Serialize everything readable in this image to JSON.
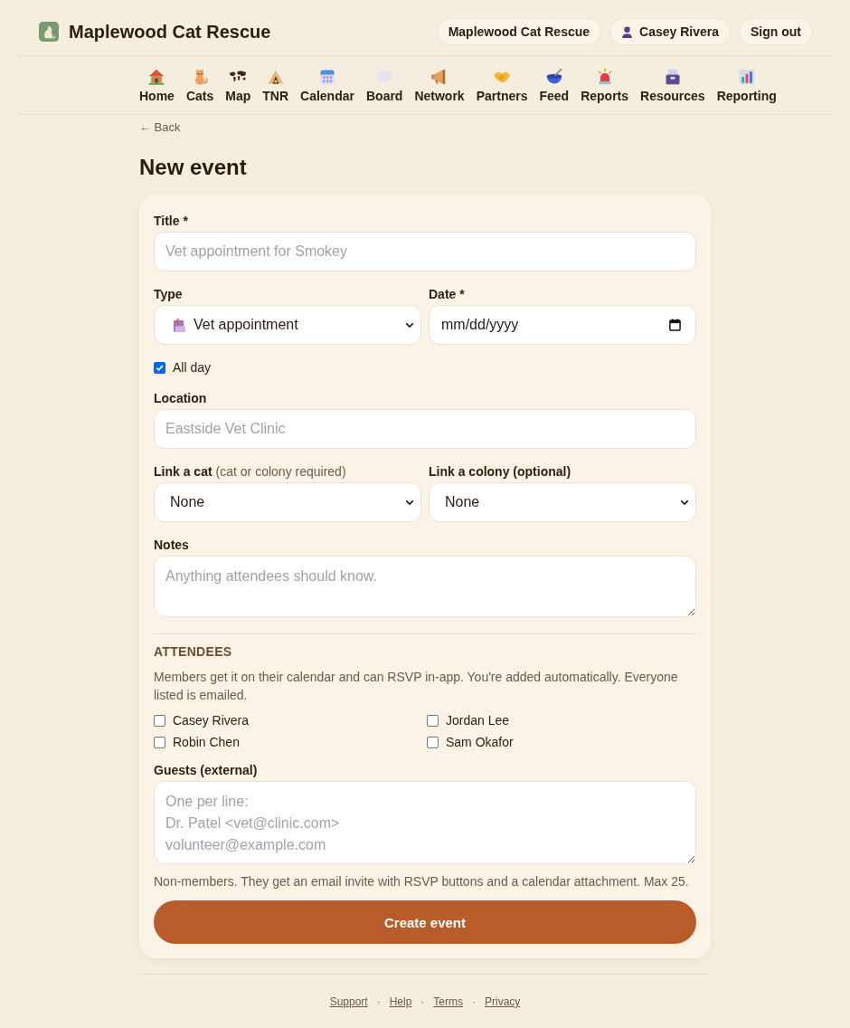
{
  "header": {
    "brand": "Maplewood Cat Rescue",
    "org_button": "Maplewood Cat Rescue",
    "user_button": "Casey Rivera",
    "sign_out_button": "Sign out"
  },
  "nav": [
    "Home",
    "Cats",
    "Map",
    "TNR",
    "Calendar",
    "Board",
    "Network",
    "Partners",
    "Feed",
    "Reports",
    "Resources",
    "Reporting"
  ],
  "back_link": "← Back",
  "page_title": "New event",
  "form": {
    "title": {
      "label": "Title *",
      "placeholder": "Vet appointment for Smokey"
    },
    "type": {
      "label": "Type",
      "value": "Vet appointment"
    },
    "date": {
      "label": "Date *",
      "placeholder": "mm/dd/yyyy"
    },
    "all_day": {
      "label": "All day",
      "checked": true
    },
    "location": {
      "label": "Location",
      "placeholder": "Eastside Vet Clinic"
    },
    "link_cat": {
      "label": "Link a cat",
      "hint": "(cat or colony required)",
      "value": "None"
    },
    "link_colony": {
      "label": "Link a colony (optional)",
      "value": "None"
    },
    "notes": {
      "label": "Notes",
      "placeholder": "Anything attendees should know."
    }
  },
  "attendees": {
    "heading": "ATTENDEES",
    "description": "Members get it on their calendar and can RSVP in-app. You're added automatically. Everyone listed is emailed.",
    "members": [
      {
        "name": "Casey Rivera",
        "checked": false
      },
      {
        "name": "Jordan Lee",
        "checked": false
      },
      {
        "name": "Robin Chen",
        "checked": false
      },
      {
        "name": "Sam Okafor",
        "checked": false
      }
    ],
    "guests": {
      "label": "Guests (external)",
      "placeholder": "One per line:\nDr. Patel <vet@clinic.com>\nvolunteer@example.com"
    },
    "guests_hint": "Non-members. They get an email invite with RSVP buttons and a calendar attachment. Max 25."
  },
  "submit_button": "Create event",
  "footer": {
    "links": [
      "Support",
      "Help",
      "Terms",
      "Privacy"
    ],
    "separator": "·"
  }
}
